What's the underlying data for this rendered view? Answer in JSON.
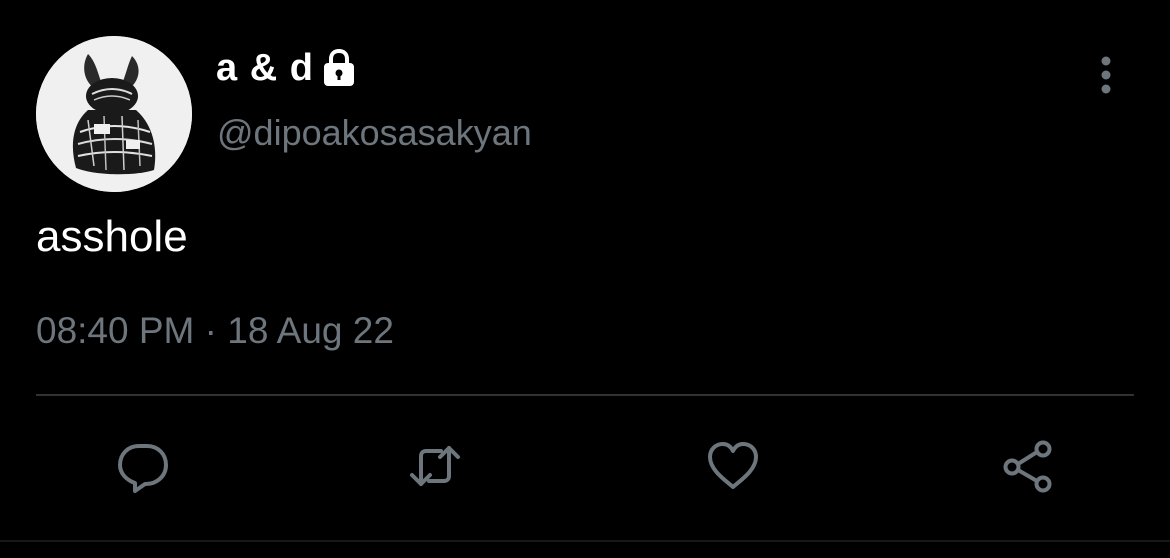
{
  "tweet": {
    "author": {
      "display_name": "a & d",
      "handle": "@dipoakosasakyan",
      "protected_icon": "lock-icon",
      "avatar": "black-and-white-bunny-figure"
    },
    "text": "asshole",
    "timestamp": "08:40 PM · 18 Aug 22",
    "menu_icon": "more-vertical-icon",
    "actions": [
      {
        "name": "reply",
        "icon": "reply-icon"
      },
      {
        "name": "retweet",
        "icon": "retweet-icon"
      },
      {
        "name": "like",
        "icon": "heart-icon"
      },
      {
        "name": "share",
        "icon": "share-icon"
      }
    ]
  },
  "colors": {
    "background": "#000000",
    "primary_text": "#ffffff",
    "secondary_text": "#6e767d",
    "divider": "#2f3336"
  }
}
